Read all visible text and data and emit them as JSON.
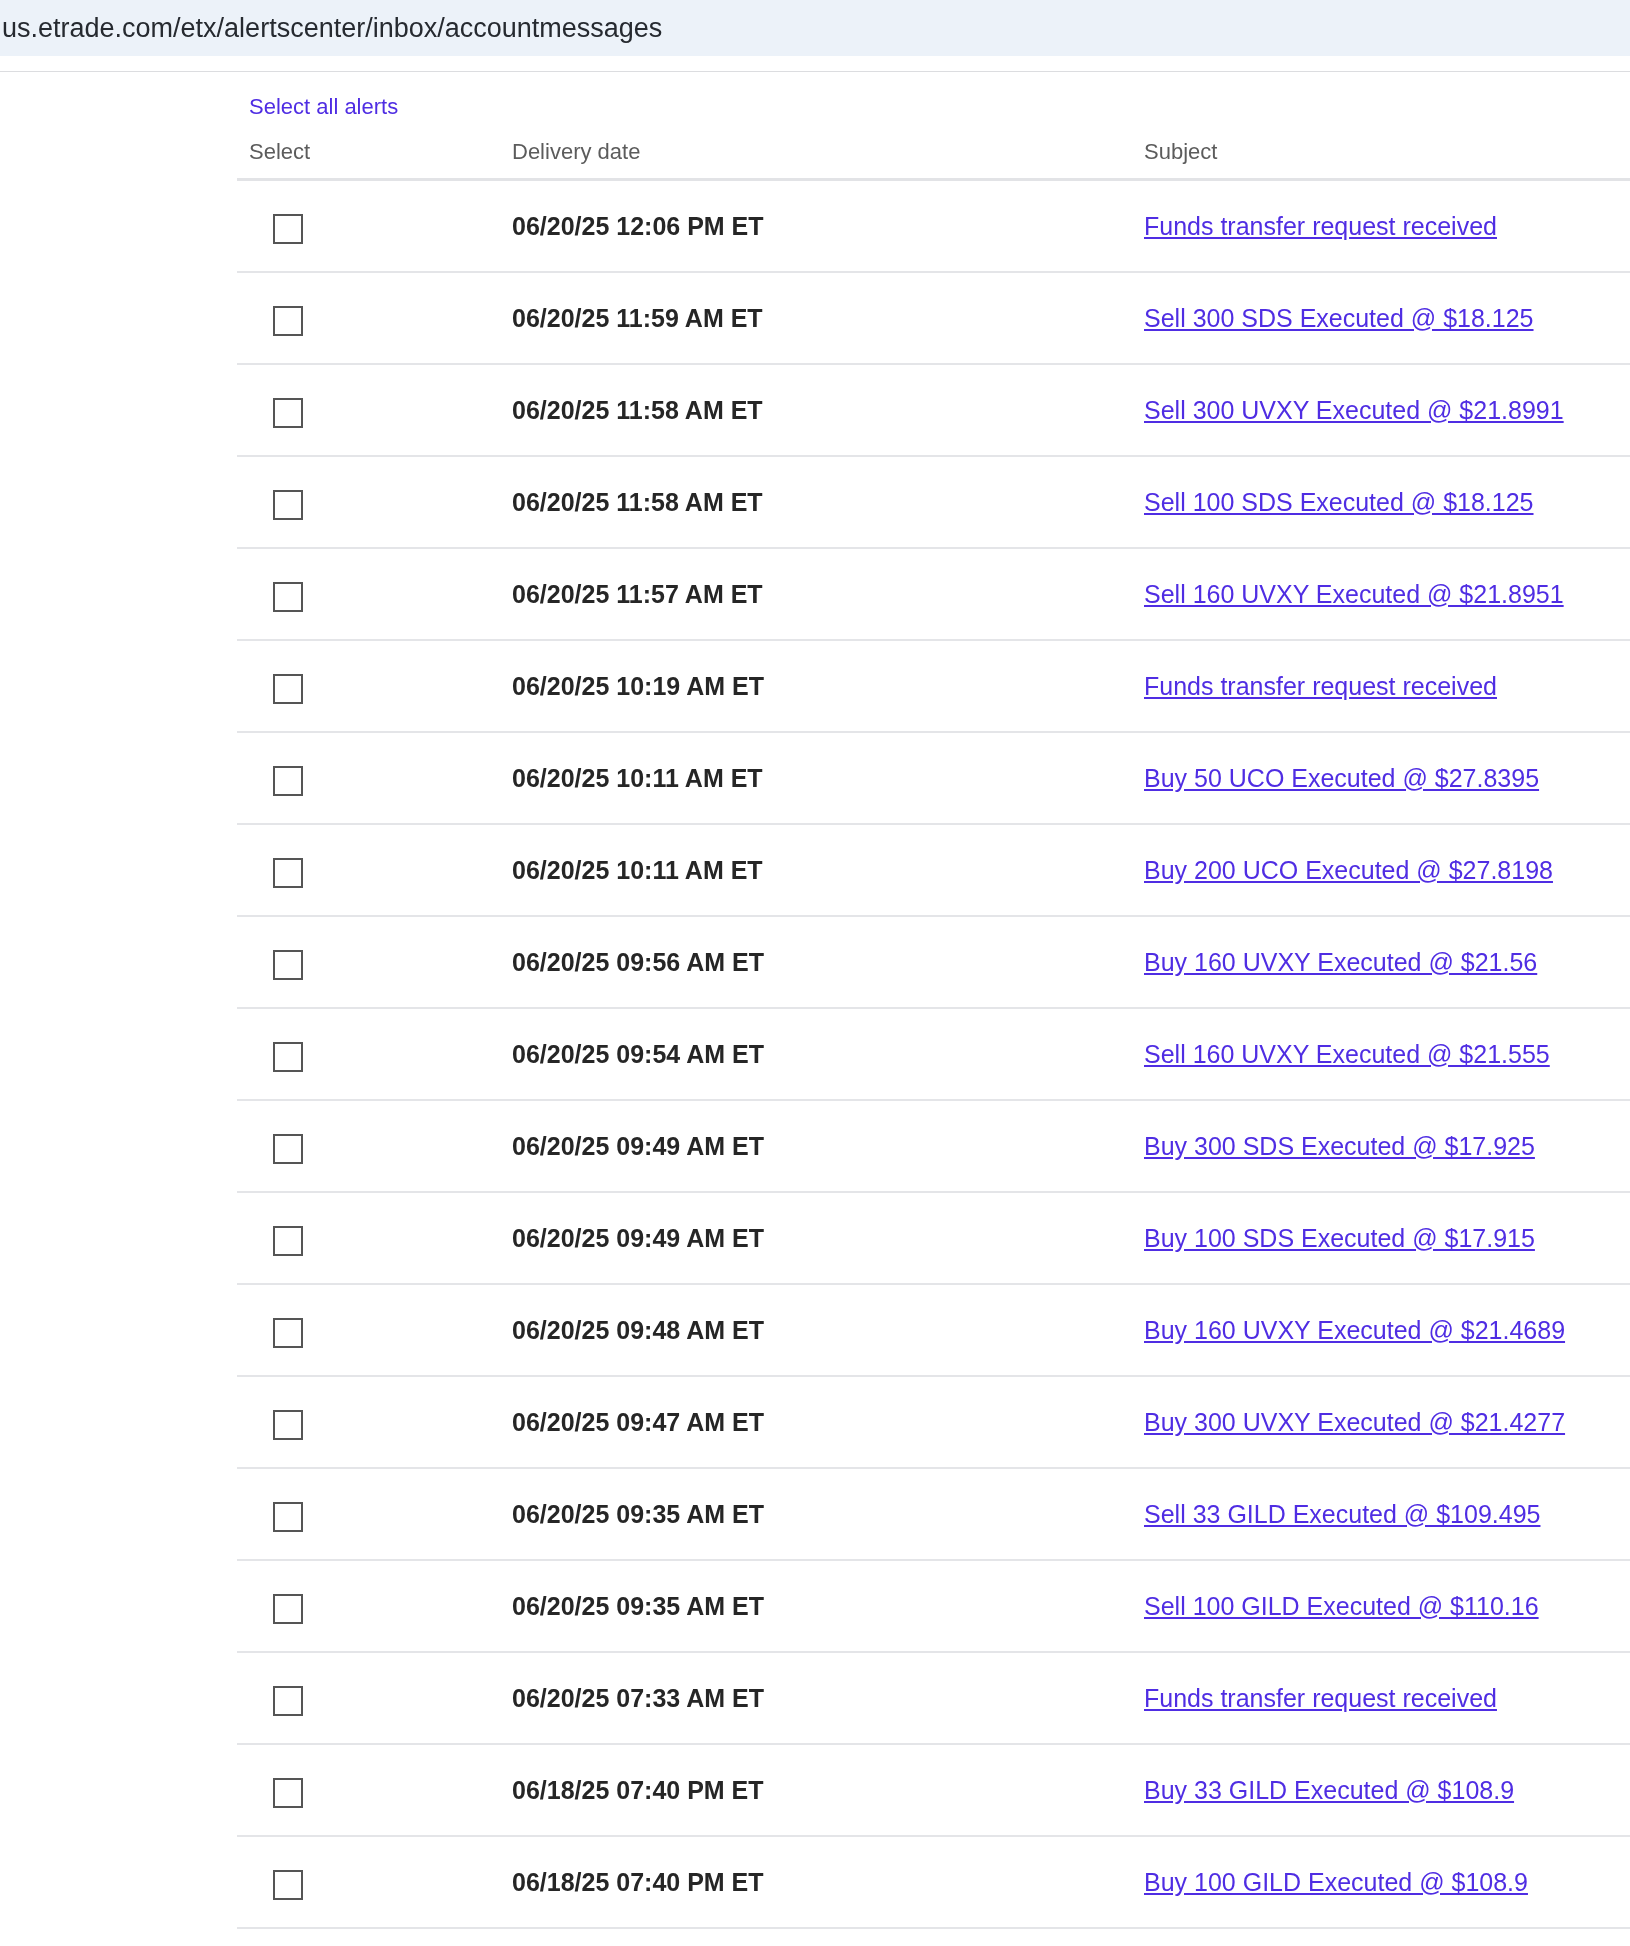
{
  "browser": {
    "url": "us.etrade.com/etx/alertscenter/inbox/accountmessages"
  },
  "select_all": "Select all alerts",
  "table": {
    "columns": [
      "Select",
      "Delivery date",
      "Subject"
    ],
    "rows": [
      {
        "checked": false,
        "delivery_date": "06/20/25 12:06 PM ET",
        "subject": "Funds transfer request received"
      },
      {
        "checked": false,
        "delivery_date": "06/20/25 11:59 AM ET",
        "subject": "Sell 300 SDS Executed @ $18.125"
      },
      {
        "checked": false,
        "delivery_date": "06/20/25 11:58 AM ET",
        "subject": "Sell 300 UVXY Executed @ $21.8991"
      },
      {
        "checked": false,
        "delivery_date": "06/20/25 11:58 AM ET",
        "subject": "Sell 100 SDS Executed @ $18.125"
      },
      {
        "checked": false,
        "delivery_date": "06/20/25 11:57 AM ET",
        "subject": "Sell 160 UVXY Executed @ $21.8951"
      },
      {
        "checked": false,
        "delivery_date": "06/20/25 10:19 AM ET",
        "subject": "Funds transfer request received"
      },
      {
        "checked": false,
        "delivery_date": "06/20/25 10:11 AM ET",
        "subject": "Buy 50 UCO Executed @ $27.8395"
      },
      {
        "checked": false,
        "delivery_date": "06/20/25 10:11 AM ET",
        "subject": "Buy 200 UCO Executed @ $27.8198"
      },
      {
        "checked": false,
        "delivery_date": "06/20/25 09:56 AM ET",
        "subject": "Buy 160 UVXY Executed @ $21.56"
      },
      {
        "checked": false,
        "delivery_date": "06/20/25 09:54 AM ET",
        "subject": "Sell 160 UVXY Executed @ $21.555"
      },
      {
        "checked": false,
        "delivery_date": "06/20/25 09:49 AM ET",
        "subject": "Buy 300 SDS Executed @ $17.925"
      },
      {
        "checked": false,
        "delivery_date": "06/20/25 09:49 AM ET",
        "subject": "Buy 100 SDS Executed @ $17.915"
      },
      {
        "checked": false,
        "delivery_date": "06/20/25 09:48 AM ET",
        "subject": "Buy 160 UVXY Executed @ $21.4689"
      },
      {
        "checked": false,
        "delivery_date": "06/20/25 09:47 AM ET",
        "subject": "Buy 300 UVXY Executed @ $21.4277"
      },
      {
        "checked": false,
        "delivery_date": "06/20/25 09:35 AM ET",
        "subject": "Sell 33 GILD Executed @ $109.495"
      },
      {
        "checked": false,
        "delivery_date": "06/20/25 09:35 AM ET",
        "subject": "Sell 100 GILD Executed @ $110.16"
      },
      {
        "checked": false,
        "delivery_date": "06/20/25 07:33 AM ET",
        "subject": "Funds transfer request received"
      },
      {
        "checked": false,
        "delivery_date": "06/18/25 07:40 PM ET",
        "subject": "Buy 33 GILD Executed @ $108.9"
      },
      {
        "checked": false,
        "delivery_date": "06/18/25 07:40 PM ET",
        "subject": "Buy 100 GILD Executed @ $108.9"
      }
    ]
  }
}
